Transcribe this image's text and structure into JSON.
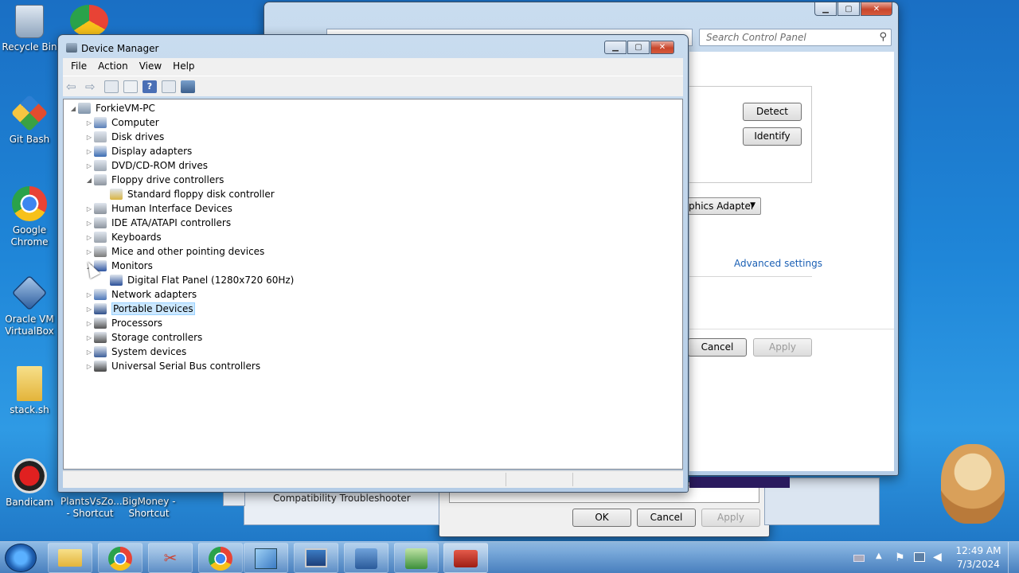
{
  "desktop": {
    "icons": [
      {
        "label": "Recycle Bin"
      },
      {
        "label": "Git Bash"
      },
      {
        "label": "Google\nChrome"
      },
      {
        "label": "Oracle VM\nVirtualBox"
      },
      {
        "label": "stack.sh"
      },
      {
        "label": "Bandicam"
      },
      {
        "label": "PlantsVsZo...\n- Shortcut"
      },
      {
        "label": "BigMoney -\nShortcut"
      }
    ]
  },
  "control_panel": {
    "search_placeholder": "Search Control Panel",
    "detect_label": "Detect",
    "identify_label": "Identify",
    "adapter_dropdown": "phics Adapter",
    "advanced_settings": "Advanced settings",
    "cancel_label": "Cancel",
    "apply_label": "Apply"
  },
  "compat_window": {
    "text": "Compatibility Troubleshooter"
  },
  "dialog": {
    "ok_label": "OK",
    "cancel_label": "Cancel",
    "apply_label": "Apply"
  },
  "device_manager": {
    "title": "Device Manager",
    "menu": [
      "File",
      "Action",
      "View",
      "Help"
    ],
    "root": "ForkieVM-PC",
    "tree": [
      {
        "label": "Computer",
        "level": 1,
        "expanded": false
      },
      {
        "label": "Disk drives",
        "level": 1,
        "expanded": false
      },
      {
        "label": "Display adapters",
        "level": 1,
        "expanded": false
      },
      {
        "label": "DVD/CD-ROM drives",
        "level": 1,
        "expanded": false
      },
      {
        "label": "Floppy drive controllers",
        "level": 1,
        "expanded": true
      },
      {
        "label": "Standard floppy disk controller",
        "level": 2,
        "expanded": false
      },
      {
        "label": "Human Interface Devices",
        "level": 1,
        "expanded": false
      },
      {
        "label": "IDE ATA/ATAPI controllers",
        "level": 1,
        "expanded": false
      },
      {
        "label": "Keyboards",
        "level": 1,
        "expanded": false
      },
      {
        "label": "Mice and other pointing devices",
        "level": 1,
        "expanded": false
      },
      {
        "label": "Monitors",
        "level": 1,
        "expanded": true
      },
      {
        "label": "Digital Flat Panel (1280x720 60Hz)",
        "level": 2,
        "expanded": false
      },
      {
        "label": "Network adapters",
        "level": 1,
        "expanded": false
      },
      {
        "label": "Portable Devices",
        "level": 1,
        "expanded": false,
        "selected": true
      },
      {
        "label": "Processors",
        "level": 1,
        "expanded": false
      },
      {
        "label": "Storage controllers",
        "level": 1,
        "expanded": false
      },
      {
        "label": "System devices",
        "level": 1,
        "expanded": false
      },
      {
        "label": "Universal Serial Bus controllers",
        "level": 1,
        "expanded": false
      }
    ]
  },
  "taskbar": {
    "time": "12:49 AM",
    "date": "7/3/2024"
  },
  "colors": {
    "selection": "#cce8ff",
    "selection_border": "#99d1ff",
    "link": "#1a5fb4"
  }
}
